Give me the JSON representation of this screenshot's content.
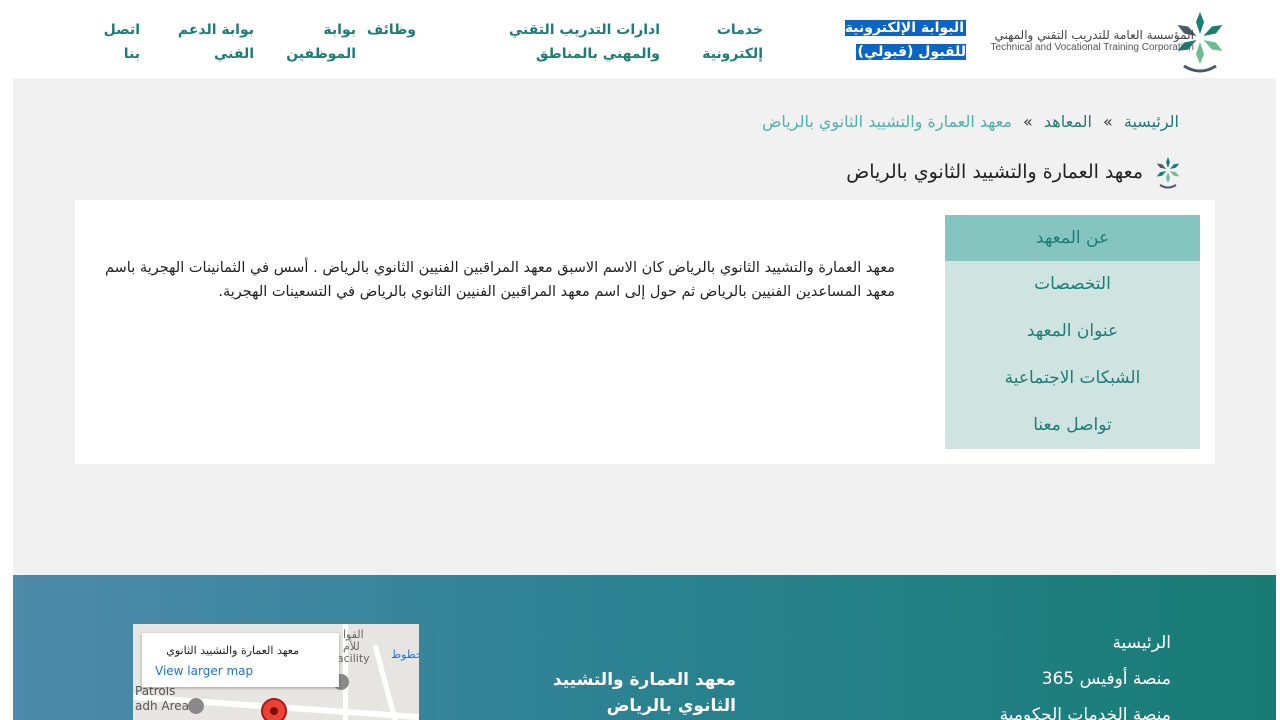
{
  "header": {
    "logo_ar": "المؤسسة العامة للتدريب التقني والمهني",
    "logo_en": "Technical and Vocational Training Corporation",
    "nav": [
      {
        "label": "البوابة الإلكترونية للقبول (قبولي)",
        "highlight": true
      },
      {
        "label": "خدمات إلكترونية"
      },
      {
        "label": "ادارات التدريب التقني والمهني بالمناطق"
      },
      {
        "label": "وظائف"
      },
      {
        "label": "بوابة الموظفين"
      },
      {
        "label": "بوابة الدعم الفني"
      },
      {
        "label": "اتصل بنا"
      }
    ]
  },
  "breadcrumb": {
    "home": "الرئيسية",
    "sep": "»",
    "institutes": "المعاهد",
    "current": "معهد العمارة والتشييد الثانوي بالرياض"
  },
  "page": {
    "title": "معهد العمارة والتشييد الثانوي بالرياض"
  },
  "side_menu": {
    "items": [
      "عن المعهد",
      "التخصصات",
      "عنوان المعهد",
      "الشبكات الاجتماعية",
      "تواصل معنا"
    ],
    "active_index": 0
  },
  "about": {
    "text": "معهد العمارة والتشييد الثانوي بالرياض كان الاسم الاسبق معهد المراقبين الفنيين الثانوي بالرياض . أسس في الثمانينات الهجرية باسم معهد المساعدين الفنيين بالرياض ثم حول إلى اسم معهد المراقبين الفنيين الثانوي بالرياض في التسعينات الهجرية."
  },
  "footer": {
    "links": [
      "الرئيسية",
      "منصة أوفيس 365",
      "منصة الخدمات الحكومية"
    ],
    "institute_title": "معهد العمارة والتشييد الثانوي بالرياض",
    "map": {
      "place_name": "معهد العمارة والتشييد الثانوي",
      "larger_map": "View larger map",
      "labels": [
        "Patrols",
        "adh Area",
        "القوا",
        "للأم",
        "facility",
        "خطوط"
      ]
    }
  },
  "colors": {
    "accent": "#1b7d76",
    "highlight": "#0a66c2",
    "menu_bg": "#cfe4e1",
    "menu_active": "#86c4bf"
  }
}
